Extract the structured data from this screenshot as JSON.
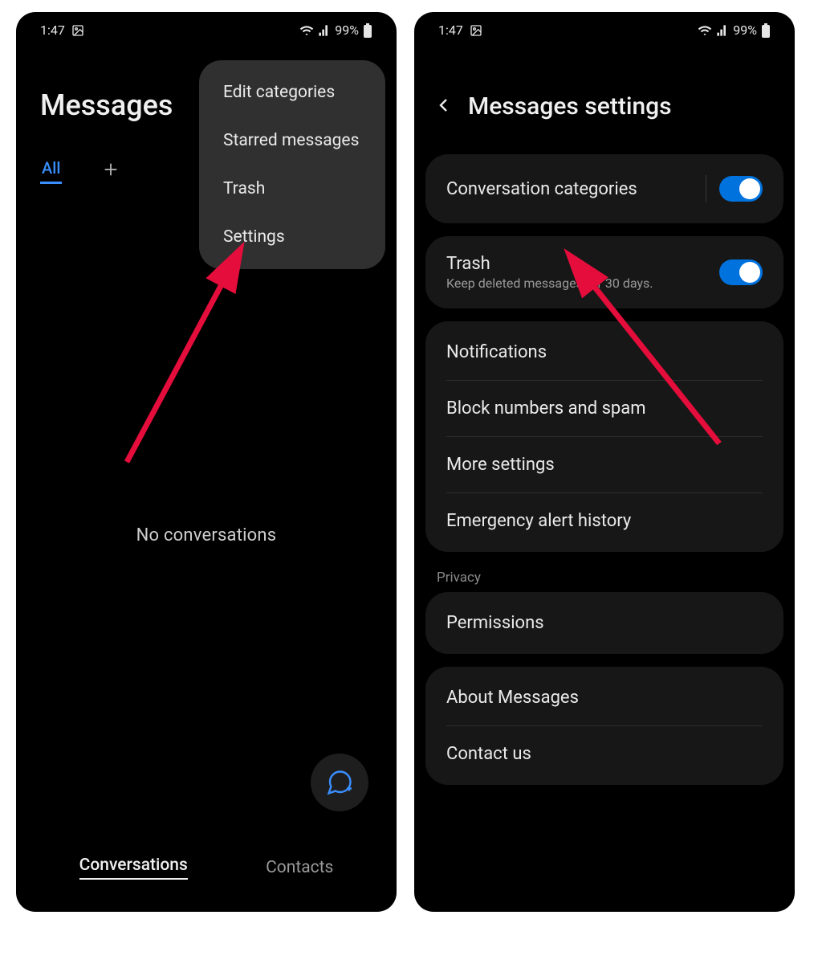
{
  "status": {
    "time": "1:47",
    "battery": "99%"
  },
  "left": {
    "title": "Messages",
    "tab_all": "All",
    "empty": "No conversations",
    "nav_conversations": "Conversations",
    "nav_contacts": "Contacts",
    "menu": {
      "edit_categories": "Edit categories",
      "starred": "Starred messages",
      "trash": "Trash",
      "settings": "Settings"
    }
  },
  "right": {
    "title": "Messages settings",
    "conv_categories": "Conversation categories",
    "trash": "Trash",
    "trash_sub": "Keep deleted messages for 30 days.",
    "notifications": "Notifications",
    "block": "Block numbers and spam",
    "more_settings": "More settings",
    "emergency": "Emergency alert history",
    "privacy_header": "Privacy",
    "permissions": "Permissions",
    "about": "About Messages",
    "contact_us": "Contact us"
  }
}
